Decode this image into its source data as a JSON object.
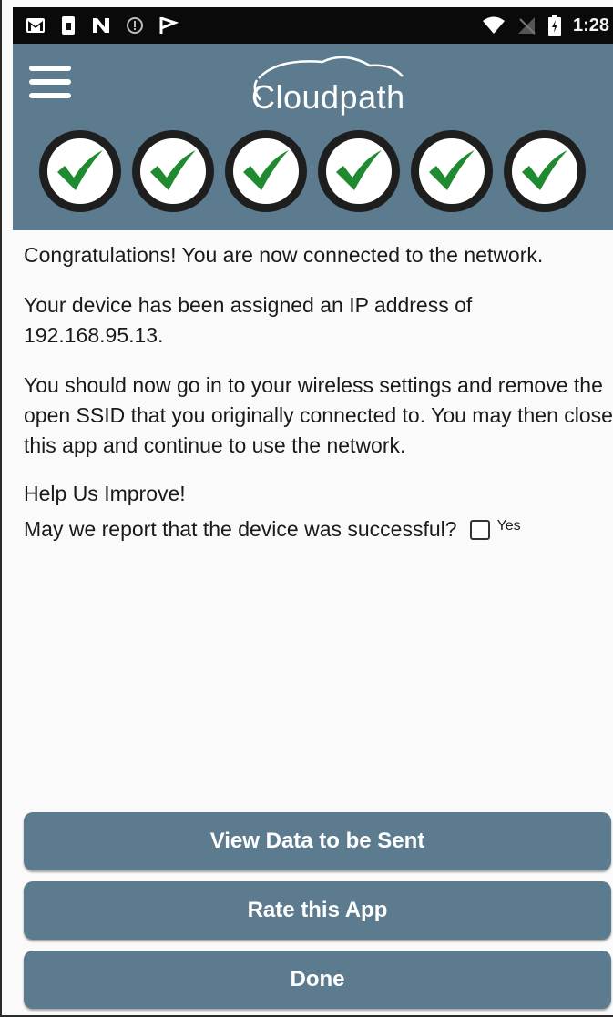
{
  "status_bar": {
    "time": "1:28",
    "icons": [
      "gmail-icon",
      "sim-icon",
      "n-icon",
      "circle-info-icon",
      "play-flag-icon",
      "wifi-icon",
      "signal-off-icon",
      "battery-icon"
    ]
  },
  "header": {
    "logo_text": "Cloudpath",
    "steps_completed": 6,
    "steps_total": 6
  },
  "content": {
    "para1": "Congratulations! You are now connected to the network.",
    "para2": "Your device has been assigned an IP address of 192.168.95.13.",
    "para3": "You should now go in to your wireless settings and remove the open SSID that you originally connected to. You may then close this app and continue to use the network.",
    "help_title": "Help Us Improve!",
    "report_question": "May we report that the device was successful?",
    "yes_label": "Yes",
    "report_checked": false
  },
  "buttons": {
    "view_data": "View Data to be Sent",
    "rate_app": "Rate this App",
    "done": "Done"
  },
  "colors": {
    "header": "#5d7b8e",
    "button": "#5d7b8e",
    "check": "#1f8a2f"
  }
}
